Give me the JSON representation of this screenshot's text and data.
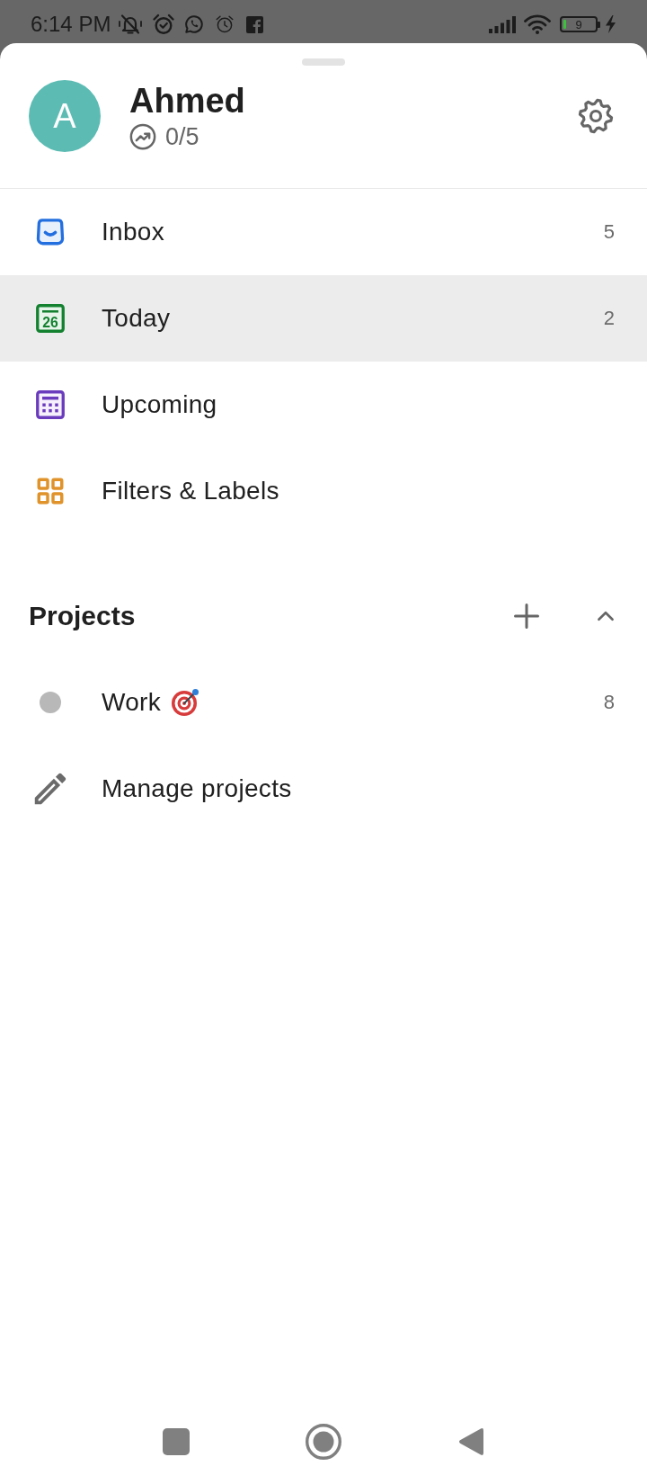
{
  "status_bar": {
    "time": "6:14 PM",
    "battery": "9"
  },
  "profile": {
    "initial": "A",
    "name": "Ahmed",
    "karma": "0/5"
  },
  "nav": [
    {
      "label": "Inbox",
      "count": "5",
      "selected": false
    },
    {
      "label": "Today",
      "date": "26",
      "count": "2",
      "selected": true
    },
    {
      "label": "Upcoming",
      "selected": false
    },
    {
      "label": "Filters & Labels",
      "selected": false
    }
  ],
  "projects": {
    "title": "Projects",
    "expanded": true,
    "items": [
      {
        "name": "Work",
        "count": "8",
        "color": "#b8b8b8"
      }
    ],
    "manage": "Manage projects"
  }
}
